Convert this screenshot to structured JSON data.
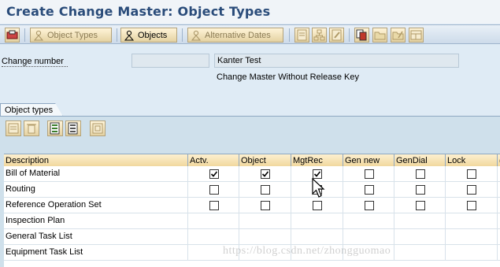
{
  "window": {
    "title": "Create Change Master: Object Types"
  },
  "toolbar": {
    "object_types_label": "Object Types",
    "objects_label": "Objects",
    "alternative_dates_label": "Alternative Dates"
  },
  "header": {
    "change_number_label": "Change number",
    "change_number_value": "",
    "description_value": "Kanter Test",
    "status_text": "Change Master Without Release Key"
  },
  "group": {
    "title": "Object types"
  },
  "table": {
    "columns": [
      "Description",
      "Actv.",
      "Object",
      "MgtRec",
      "Gen new",
      "GenDial",
      "Lock",
      "("
    ],
    "rows": [
      {
        "description": "Bill of Material",
        "checkboxes": [
          true,
          true,
          true,
          false,
          false,
          false
        ]
      },
      {
        "description": "Routing",
        "checkboxes": [
          false,
          false,
          false,
          false,
          false,
          false
        ]
      },
      {
        "description": "Reference Operation Set",
        "checkboxes": [
          false,
          false,
          false,
          false,
          false,
          false
        ]
      },
      {
        "description": "Inspection Plan",
        "checkboxes": []
      },
      {
        "description": "General Task List",
        "checkboxes": []
      },
      {
        "description": "Equipment Task List",
        "checkboxes": []
      }
    ]
  },
  "watermark": "https://blog.csdn.net/zhongguomao",
  "colors": {
    "title": "#2a4c7a",
    "background": "#dfebf5",
    "header": "#f1d89e"
  }
}
